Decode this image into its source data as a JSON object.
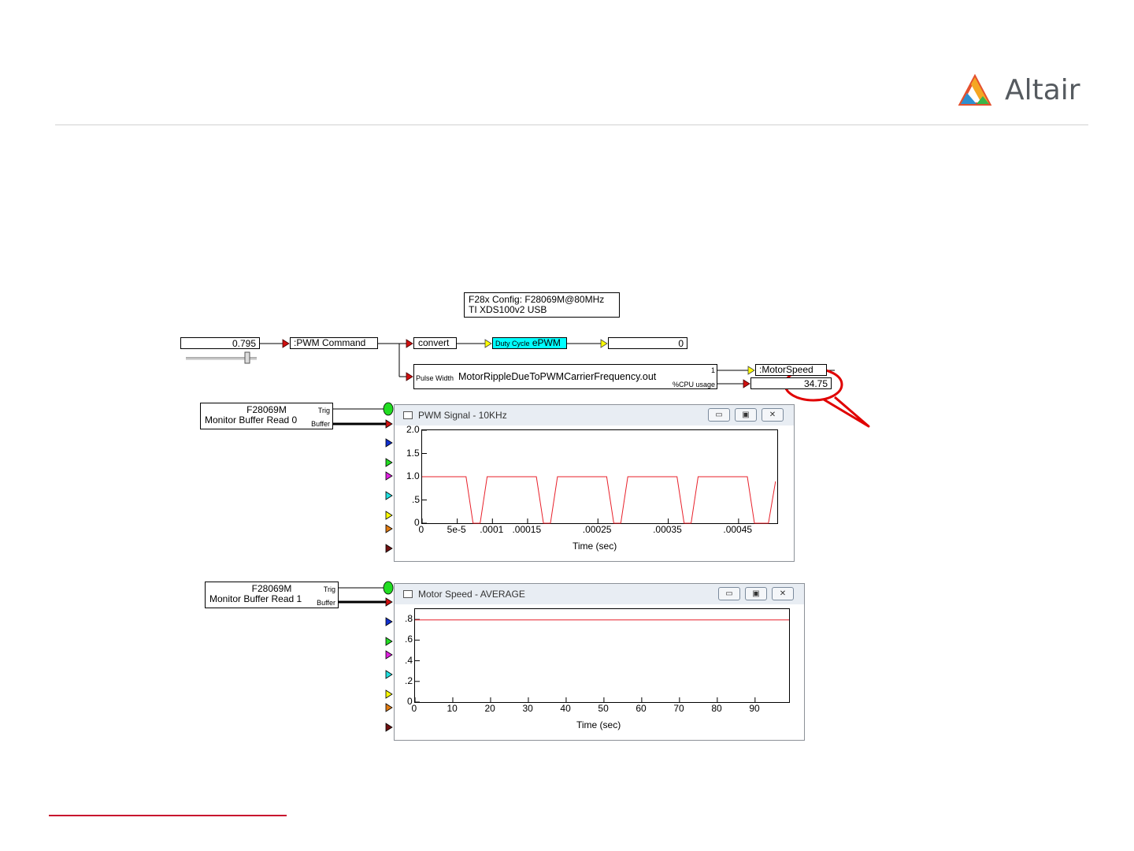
{
  "brand": {
    "name": "Altair"
  },
  "config": {
    "line1": "F28x Config: F28069M@80MHz",
    "line2": "TI XDS100v2 USB"
  },
  "blocks": {
    "slider_value": "0.795",
    "pwm_command": ":PWM Command",
    "convert": "convert",
    "epwm_small": "Duty Cycle",
    "epwm": "ePWM",
    "epwm_out": "0",
    "pulse_label": "Pulse Width",
    "motor_file": "MotorRippleDueToPWMCarrierFrequency.out",
    "port_1": "1",
    "cpu_label": "%CPU usage",
    "motor_speed": ":MotorSpeed",
    "cpu_value": "34.75"
  },
  "monitors": [
    {
      "device": "F28069M",
      "label": "Monitor Buffer Read 0",
      "trig": "Trig",
      "buffer": "Buffer"
    },
    {
      "device": "F28069M",
      "label": "Monitor Buffer Read 1",
      "trig": "Trig",
      "buffer": "Buffer"
    }
  ],
  "windows": [
    {
      "title": "PWM Signal - 10KHz",
      "xlabel": "Time (sec)"
    },
    {
      "title": "Motor Speed - AVERAGE",
      "xlabel": "Time (sec)"
    }
  ],
  "colors": {
    "signal": "#e8202a",
    "epwm": "#00ffff",
    "highlight": "#e00000",
    "trig": "#22dd22"
  },
  "chart_data": [
    {
      "type": "line",
      "title": "PWM Signal - 10KHz",
      "xlabel": "Time (sec)",
      "xlim": [
        0,
        0.000505
      ],
      "ylim": [
        0,
        2.0
      ],
      "xticks": [
        0,
        5e-05,
        0.0001,
        0.00015,
        0.00025,
        0.00035,
        0.00045
      ],
      "xtick_labels": [
        "0",
        "5e-5",
        ".0001",
        ".00015",
        ".00025",
        ".00035",
        ".00045"
      ],
      "yticks": [
        0,
        0.5,
        1.0,
        1.5,
        2.0
      ],
      "ytick_labels": [
        "0",
        ".5",
        "1.0",
        "1.5",
        "2.0"
      ],
      "series": [
        {
          "x": [
            0,
            6.25e-05,
            7.25e-05,
            8.25e-05,
            9.25e-05,
            0.0001625,
            0.0001725,
            0.0001825,
            0.0001925,
            0.0002625,
            0.0002725,
            0.0002825,
            0.0002925,
            0.0003625,
            0.0003725,
            0.0003825,
            0.0003925,
            0.0004625,
            0.0004725,
            0.0004925,
            0.0005025
          ],
          "y": [
            1,
            1,
            0,
            0,
            1,
            1,
            0,
            0,
            1,
            1,
            0,
            0,
            1,
            1,
            0,
            0,
            1,
            1,
            0,
            0,
            0.9
          ]
        }
      ]
    },
    {
      "type": "line",
      "title": "Motor Speed - AVERAGE",
      "xlabel": "Time (sec)",
      "xlim": [
        0,
        99
      ],
      "ylim": [
        0,
        0.9
      ],
      "xticks": [
        0,
        10,
        20,
        30,
        40,
        50,
        60,
        70,
        80,
        90
      ],
      "xtick_labels": [
        "0",
        "10",
        "20",
        "30",
        "40",
        "50",
        "60",
        "70",
        "80",
        "90"
      ],
      "yticks": [
        0,
        0.2,
        0.4,
        0.6,
        0.8
      ],
      "ytick_labels": [
        "0",
        ".2",
        ".4",
        ".6",
        ".8"
      ],
      "series": [
        {
          "x": [
            0,
            99
          ],
          "y": [
            0.795,
            0.795
          ]
        }
      ]
    }
  ]
}
